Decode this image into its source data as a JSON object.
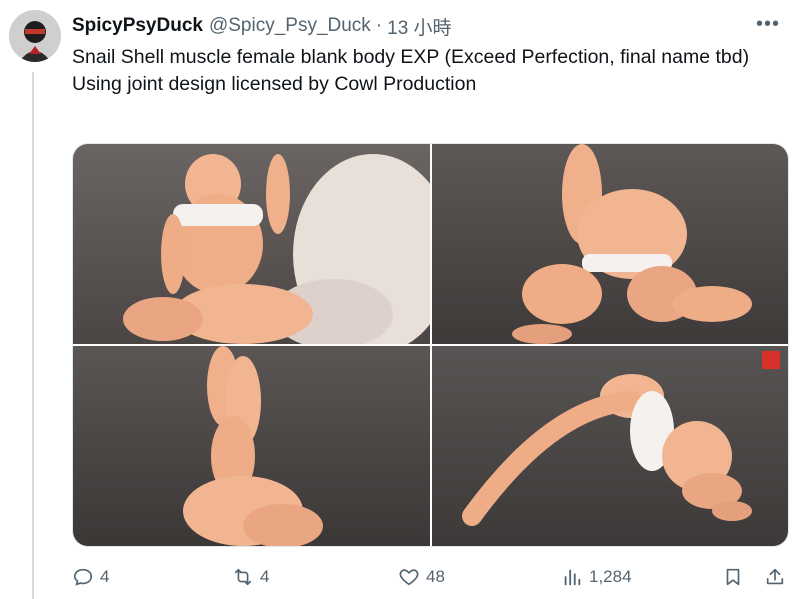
{
  "post": {
    "display_name": "SpicyPsyDuck",
    "handle": "@Spicy_Psy_Duck",
    "separator": "·",
    "time": "13 小時",
    "more": "•••",
    "text_line1": "Snail Shell muscle female blank body EXP (Exceed Perfection, final name tbd)",
    "text_line2": "Using joint design licensed by Cowl Production"
  },
  "media": {
    "photos": [
      {
        "name": "photo-kneeling-pose"
      },
      {
        "name": "photo-bridge-pose"
      },
      {
        "name": "photo-legs-up-pose"
      },
      {
        "name": "photo-stretch-pose"
      }
    ]
  },
  "actions": {
    "reply_count": "4",
    "retweet_count": "4",
    "like_count": "48",
    "views_count": "1,284"
  },
  "colors": {
    "text": "#0f1419",
    "secondary": "#536471",
    "figure_skin": "#f2b592",
    "backdrop": "#5a5654"
  }
}
